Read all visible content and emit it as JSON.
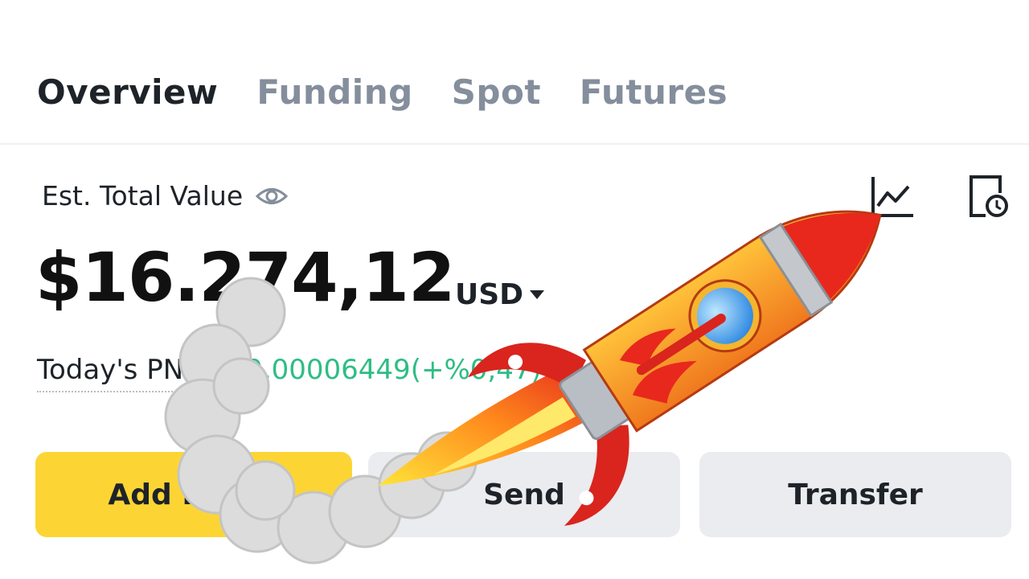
{
  "tabs": [
    {
      "label": "Overview",
      "active": true
    },
    {
      "label": "Funding",
      "active": false
    },
    {
      "label": "Spot",
      "active": false
    },
    {
      "label": "Futures",
      "active": false
    }
  ],
  "summary": {
    "est_label": "Est. Total Value",
    "balance": "$16.274,12",
    "currency": "USD",
    "pnl_label": "Today's PNL",
    "pnl_value": "+$0,00006449(+%0,47)"
  },
  "icons": {
    "visibility": "eye-icon",
    "chart": "line-chart-icon",
    "history": "history-clock-icon",
    "currency_selector": "caret-down-icon"
  },
  "actions": {
    "add_funds": "Add Funds",
    "send": "Send",
    "transfer": "Transfer"
  },
  "colors": {
    "accent": "#fcd535",
    "positive": "#2ebd85",
    "text_primary": "#1e2329",
    "text_secondary": "#848e9c",
    "button_secondary": "#eaecef"
  },
  "overlay": {
    "graphic": "rocket-illustration",
    "smoke": "smoke-trail"
  }
}
